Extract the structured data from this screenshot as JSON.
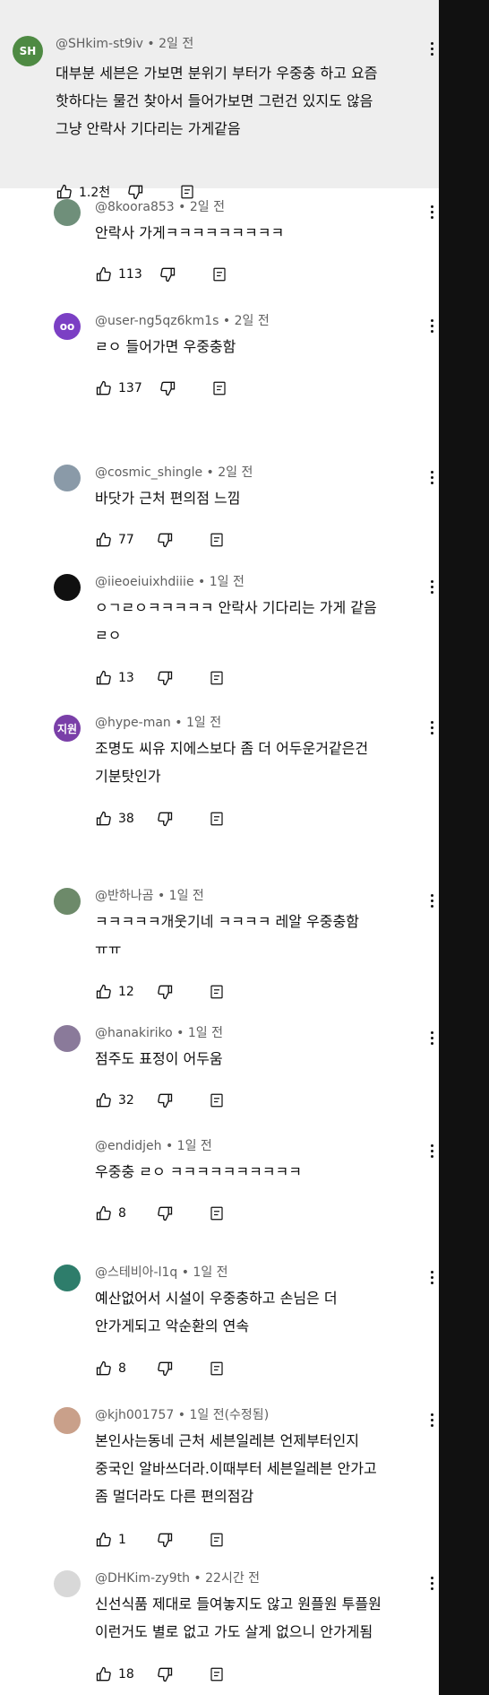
{
  "colors": {
    "sidebar": "#111111",
    "highlight_bg": "#eeeeee",
    "secondary_text": "#606060"
  },
  "comments": [
    {
      "avatar_text": "SH",
      "avatar_color": "#4e8a43",
      "handle": "@SHkim-st9iv • 2일 전",
      "text": [
        "대부분 세븐은 가보면 분위기 부터가 우중충 하고 요즘",
        "핫하다는 물건 찾아서 들어가보면 그런건 있지도 않음",
        "그냥 안락사 기다리는 가게같음"
      ],
      "likes": "1.2천"
    },
    {
      "avatar_text": "",
      "avatar_color": "#6f8f7a",
      "handle": "@8koora853 • 2일 전",
      "text": [
        "안락사 가게ㅋㅋㅋㅋㅋㅋㅋㅋㅋ"
      ],
      "likes": "113"
    },
    {
      "avatar_text": "oo",
      "avatar_color": "#7b3fc4",
      "handle": "@user-ng5qz6km1s • 2일 전",
      "text": [
        "ㄹㅇ 들어가면 우중충함"
      ],
      "likes": "137"
    },
    {
      "avatar_text": "",
      "avatar_color": "#8a9aa8",
      "handle": "@cosmic_shingle • 2일 전",
      "text": [
        "바닷가 근처 편의점 느낌"
      ],
      "likes": "77"
    },
    {
      "avatar_text": "",
      "avatar_color": "#101010",
      "handle": "@iieoeiuixhdiiie • 1일 전",
      "text": [
        "ㅇㄱㄹㅇㅋㅋㅋㅋㅋ 안락사 기다리는 가게 같음",
        "ㄹㅇ"
      ],
      "likes": "13"
    },
    {
      "avatar_text": "지원",
      "avatar_color": "#7a3fa8",
      "handle": "@hype-man • 1일 전",
      "text": [
        "조명도 씨유 지에스보다 좀 더 어두운거같은건",
        "기분탓인가"
      ],
      "likes": "38"
    },
    {
      "avatar_text": "",
      "avatar_color": "#6d8a6a",
      "handle": "@반하나곰 • 1일 전",
      "text": [
        "ㅋㅋㅋㅋㅋ개웃기네 ㅋㅋㅋㅋ 레알 우중충함",
        "ㅠㅠ"
      ],
      "likes": "12"
    },
    {
      "avatar_text": "",
      "avatar_color": "#8a7a9a",
      "handle": "@hanakiriko • 1일 전",
      "text": [
        "점주도 표정이 어두움"
      ],
      "likes": "32"
    },
    {
      "avatar_text": "",
      "avatar_color": "",
      "handle": "@endidjeh • 1일 전",
      "text": [
        "우중충 ㄹㅇ ㅋㅋㅋㅋㅋㅋㅋㅋㅋㅋ"
      ],
      "likes": "8"
    },
    {
      "avatar_text": "",
      "avatar_color": "#2e7d6b",
      "handle": "@스테비아-l1q • 1일 전",
      "text": [
        "예산없어서 시설이 우중충하고 손님은 더",
        "안가게되고 악순환의 연속"
      ],
      "likes": "8"
    },
    {
      "avatar_text": "",
      "avatar_color": "#c9a08a",
      "handle": "@kjh001757 • 1일 전(수정됨)",
      "text": [
        "본인사는동네 근처 세븐일레븐 언제부터인지",
        "중국인 알바쓰더라.이때부터 세븐일레븐 안가고",
        "좀 멀더라도 다른 편의점감"
      ],
      "likes": "1"
    },
    {
      "avatar_text": "",
      "avatar_color": "#d8d8d8",
      "handle": "@DHKim-zy9th • 22시간 전",
      "text": [
        "신선식품 제대로 들여놓지도 않고 원플원 투플원",
        "이런거도 별로 없고 가도 살게 없으니 안가게됨"
      ],
      "likes": "18"
    }
  ]
}
